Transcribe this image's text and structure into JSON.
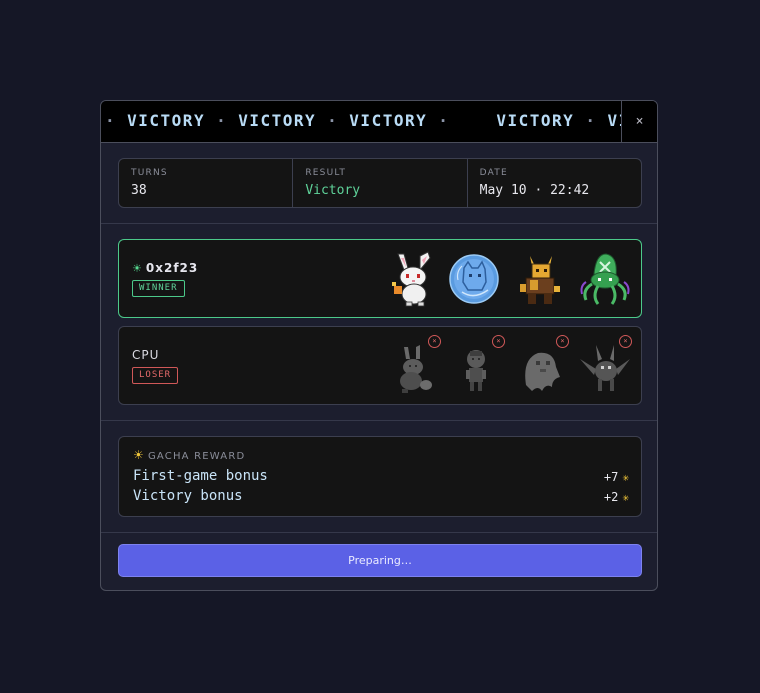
{
  "marquee": {
    "word": "VICTORY",
    "separator": "·"
  },
  "close_label": "×",
  "stats": [
    {
      "label": "TURNS",
      "value": "38"
    },
    {
      "label": "RESULT",
      "value": "Victory"
    },
    {
      "label": "DATE",
      "value": "May 10 · 22:42"
    }
  ],
  "teams": {
    "winner": {
      "name": "0x2f23",
      "badge": "WINNER",
      "icon": "sun-icon",
      "creatures": [
        "white-rabbit-icon",
        "blue-orb-creature-icon",
        "horned-warrior-icon",
        "green-octopus-icon"
      ]
    },
    "loser": {
      "name": "CPU",
      "badge": "LOSER",
      "ko_mark": "×",
      "creatures": [
        "shadow-rabbit-icon",
        "shadow-child-icon",
        "shadow-ghost-icon",
        "shadow-bat-icon"
      ]
    }
  },
  "reward": {
    "title": "GACHA REWARD",
    "icon": "sun-icon",
    "rows": [
      {
        "label": "First-game bonus",
        "amount": "+7"
      },
      {
        "label": "Victory bonus",
        "amount": "+2"
      }
    ]
  },
  "action_label": "Preparing…",
  "colors": {
    "accent": "#5b61e6",
    "win": "#4cc98a",
    "lose": "#d05858",
    "currency": "#f0c63a"
  }
}
